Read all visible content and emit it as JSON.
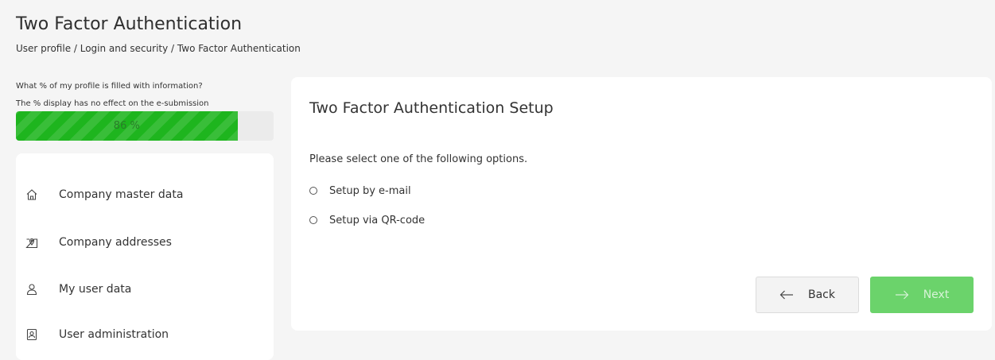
{
  "header": {
    "title": "Two Factor Authentication",
    "breadcrumb": "User profile / Login and security / Two Factor Authentication"
  },
  "profile_progress": {
    "question": "What % of my profile is filled with information?",
    "note": "The % display has no effect on the e-submission",
    "percent": 86,
    "label": "86 %",
    "fill_color": "#1eb51e"
  },
  "sidebar": {
    "items": [
      {
        "label": "Company master data",
        "icon": "home-icon"
      },
      {
        "label": "Company addresses",
        "icon": "map-pin-icon"
      },
      {
        "label": "My user data",
        "icon": "user-icon"
      },
      {
        "label": "User administration",
        "icon": "user-card-icon"
      }
    ]
  },
  "main": {
    "title": "Two Factor Authentication Setup",
    "instruction": "Please select one of the following options.",
    "options": [
      {
        "label": "Setup by e-mail",
        "selected": false
      },
      {
        "label": "Setup via QR-code",
        "selected": false
      }
    ],
    "back_label": "Back",
    "next_label": "Next",
    "next_color": "#6bd36b"
  }
}
